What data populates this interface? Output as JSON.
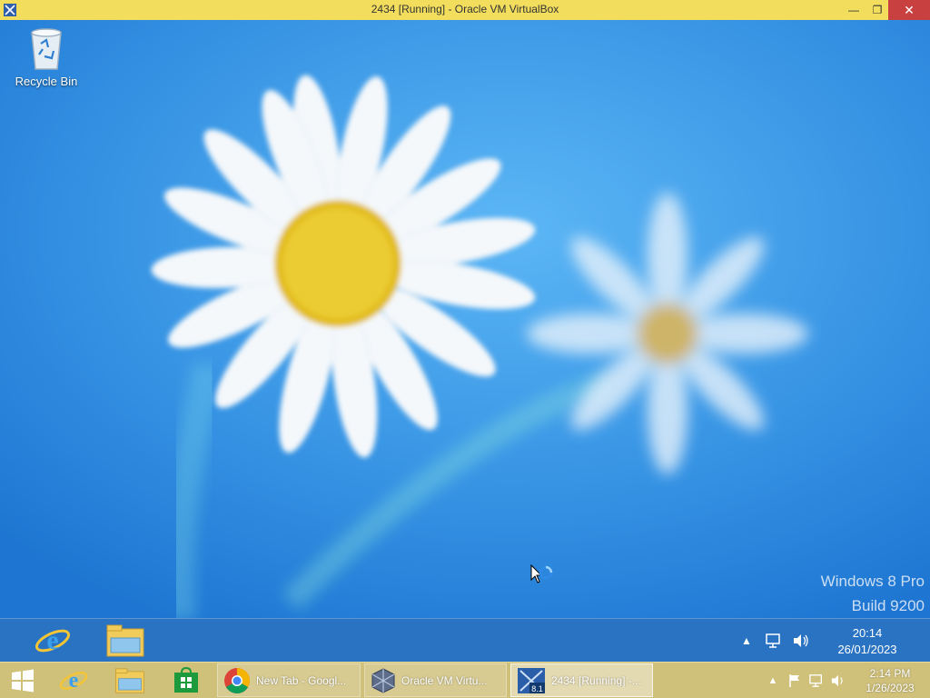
{
  "host_window": {
    "title": "2434 [Running] - Oracle VM VirtualBox",
    "minimize": "—",
    "restore": "❐",
    "close": "✕"
  },
  "desktop": {
    "icons": [
      {
        "label": "Recycle Bin",
        "icon": "recycle-bin-icon"
      }
    ],
    "watermark_line1": "Windows 8 Pro",
    "watermark_line2": "Build 9200"
  },
  "guest_taskbar": {
    "pinned": [
      {
        "name": "internet-explorer",
        "icon": "internet-explorer-icon"
      },
      {
        "name": "file-explorer",
        "icon": "file-explorer-icon"
      }
    ],
    "tray_chevron": "▲",
    "clock_time": "20:14",
    "clock_date": "26/01/2023"
  },
  "host_taskbar": {
    "pinned": [
      {
        "name": "internet-explorer",
        "icon": "internet-explorer-icon"
      },
      {
        "name": "file-explorer",
        "icon": "file-explorer-icon"
      },
      {
        "name": "store",
        "icon": "store-icon"
      }
    ],
    "tasks": [
      {
        "label": "New Tab - Googl...",
        "icon": "chrome-icon",
        "active": false
      },
      {
        "label": "Oracle VM Virtu...",
        "icon": "virtualbox-icon",
        "active": false
      },
      {
        "label": "2434 [Running] -...",
        "icon": "virtualbox-vm-icon",
        "active": true,
        "badge": "8.1"
      }
    ],
    "tray_chevron": "▲",
    "clock_time": "2:14 PM",
    "clock_date": "1/26/2023"
  },
  "colors": {
    "host_titlebar": "#f2de5c",
    "host_taskbar": "#cfc07a",
    "close_button": "#c84040",
    "wallpaper": "#2f8ae0"
  }
}
